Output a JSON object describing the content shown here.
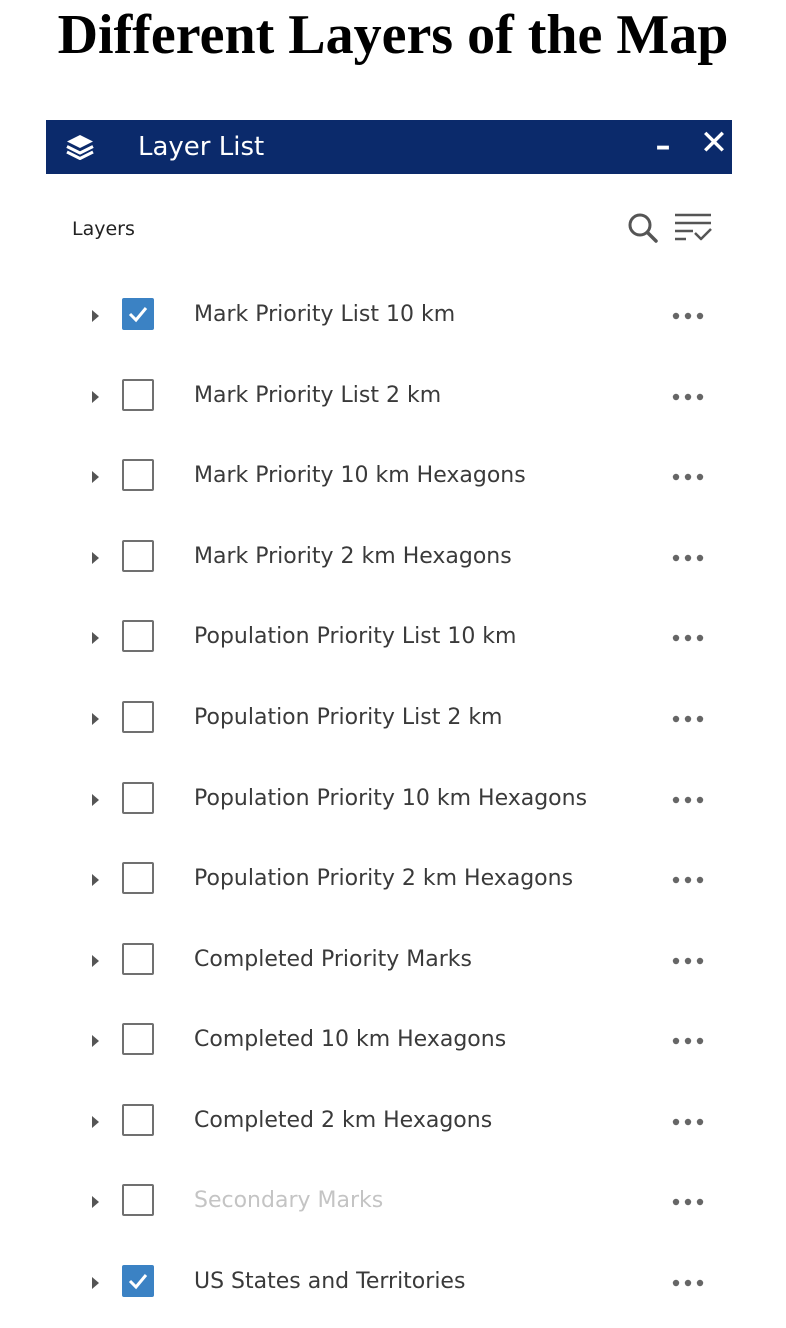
{
  "page": {
    "title": "Different Layers of the Map"
  },
  "panel": {
    "title": "Layer List",
    "minimize_label": "–",
    "close_label": "✕",
    "section_label": "Layers",
    "icons": {
      "header": "layers-stack-icon",
      "search": "search-icon",
      "filter": "filter-list-icon",
      "more": "more-options-icon",
      "expand": "caret-right-icon"
    },
    "colors": {
      "header_bg": "#0b2a6b",
      "checkbox_checked": "#3b82c4"
    }
  },
  "layers": [
    {
      "label": "Mark Priority List 10 km",
      "checked": true,
      "enabled": true
    },
    {
      "label": "Mark Priority List 2 km",
      "checked": false,
      "enabled": true
    },
    {
      "label": "Mark Priority 10 km Hexagons",
      "checked": false,
      "enabled": true
    },
    {
      "label": "Mark Priority 2 km Hexagons",
      "checked": false,
      "enabled": true
    },
    {
      "label": "Population Priority List 10 km",
      "checked": false,
      "enabled": true
    },
    {
      "label": "Population Priority List 2 km",
      "checked": false,
      "enabled": true
    },
    {
      "label": "Population Priority 10 km Hexagons",
      "checked": false,
      "enabled": true
    },
    {
      "label": "Population Priority 2 km Hexagons",
      "checked": false,
      "enabled": true
    },
    {
      "label": "Completed Priority Marks",
      "checked": false,
      "enabled": true
    },
    {
      "label": "Completed 10 km Hexagons",
      "checked": false,
      "enabled": true
    },
    {
      "label": "Completed 2 km Hexagons",
      "checked": false,
      "enabled": true
    },
    {
      "label": "Secondary Marks",
      "checked": false,
      "enabled": false
    },
    {
      "label": "US States and Territories",
      "checked": true,
      "enabled": true
    }
  ]
}
